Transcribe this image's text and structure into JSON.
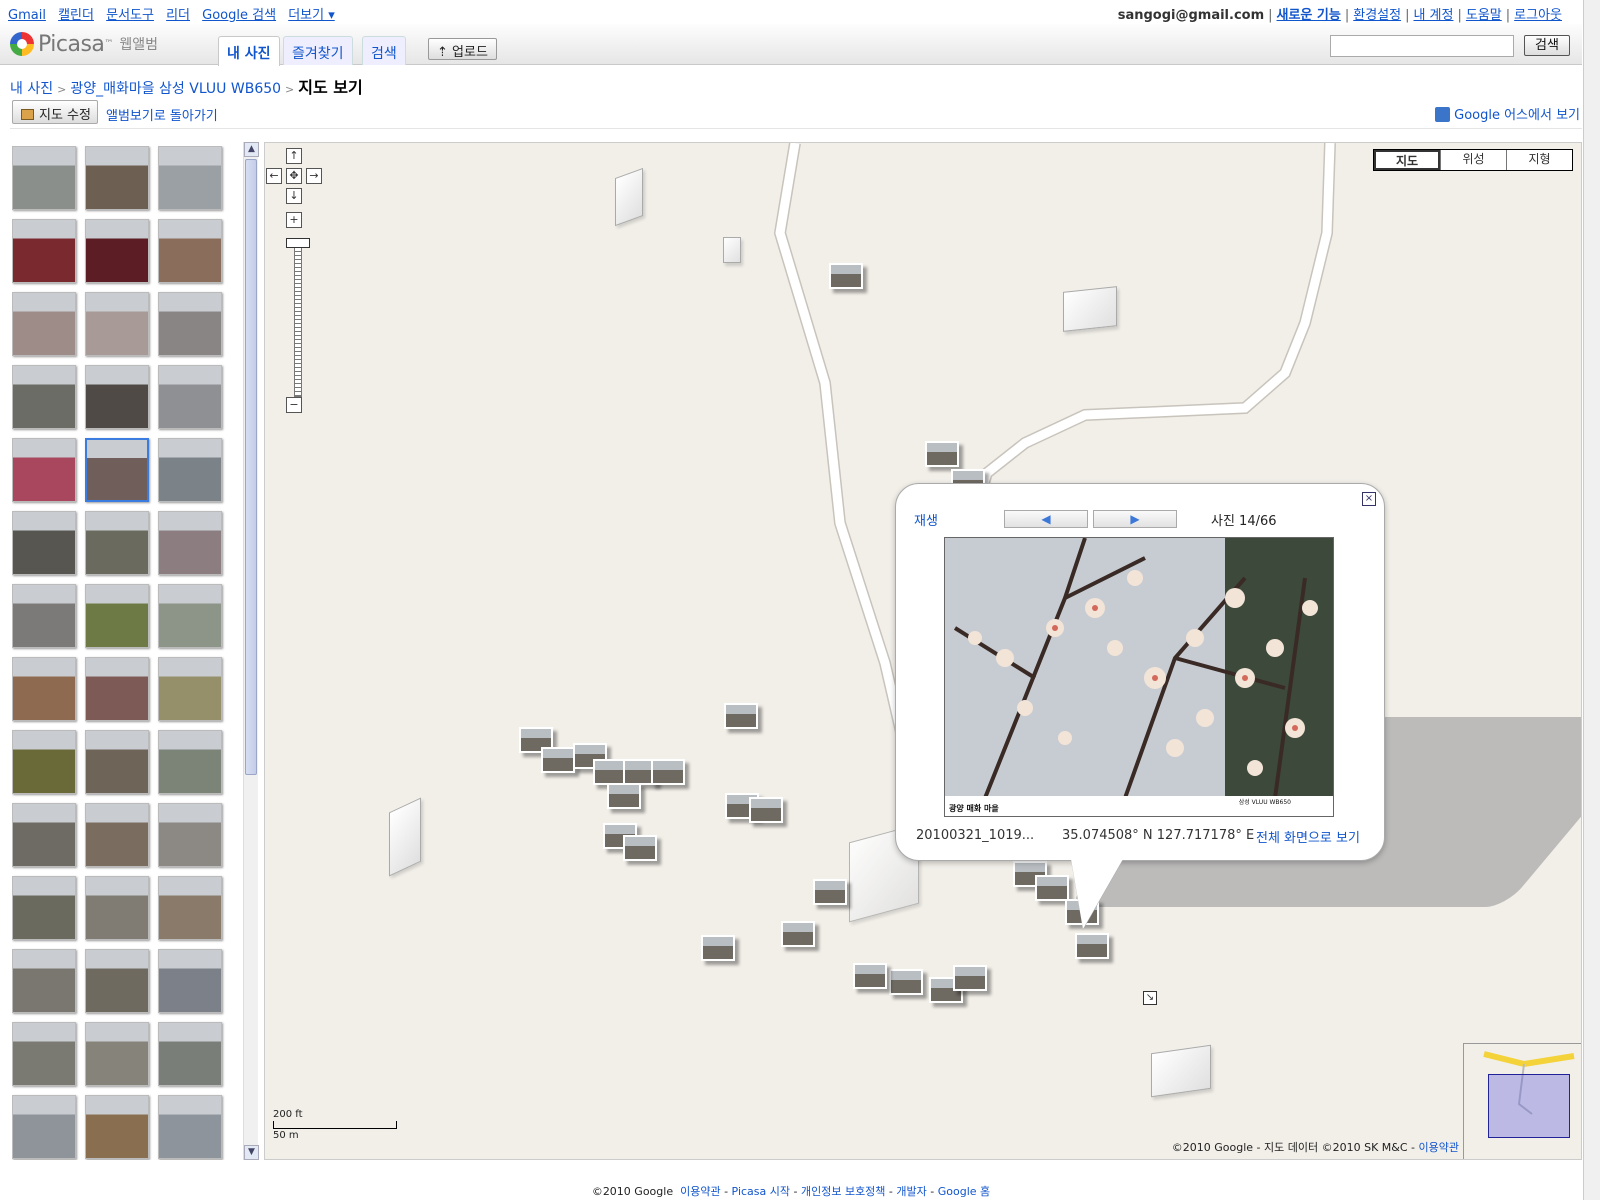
{
  "topbar": {
    "links": [
      "Gmail",
      "캘린더",
      "문서도구",
      "리더",
      "Google 검색",
      "더보기 ▾"
    ],
    "email": "sangogi@gmail.com",
    "right_links": [
      "새로운 기능",
      "환경설정",
      "내 계정",
      "도움말",
      "로그아웃"
    ]
  },
  "header": {
    "logo_word": "Picasa",
    "logo_tm": "™",
    "logo_sub": "웹앨범",
    "tabs": [
      "내 사진",
      "즐겨찾기",
      "검색"
    ],
    "upload": "업로드",
    "search_button": "검색",
    "search_value": ""
  },
  "breadcrumb": {
    "items": [
      "내 사진",
      "광양_매화마을 삼성 VLUU WB650"
    ],
    "current": "지도 보기"
  },
  "actions": {
    "edit_map": "지도 수정",
    "back_to_album": "앨범보기로 돌아가기",
    "google_earth": "Google 어스에서 보기"
  },
  "thumbnails": {
    "selected_index": 13,
    "count_visible": 42
  },
  "map": {
    "nav": {
      "up": "↑",
      "left": "←",
      "center": "✥",
      "right": "→",
      "down": "↓",
      "zoom_in": "+",
      "zoom_out": "−"
    },
    "types": [
      "지도",
      "위성",
      "지형"
    ],
    "scale": {
      "ft": "200 ft",
      "m": "50 m"
    },
    "copyright": "©2010 Google - 지도 데이터 ©2010 SK M&C - ",
    "copyright_link": "이용약관",
    "expand_icon": "↘"
  },
  "popup": {
    "play": "재생",
    "prev": "◀",
    "next": "▶",
    "counter": "사진 14/66",
    "filename": "20100321_1019...",
    "coords": "35.074508° N  127.717178° E",
    "fullscreen": "전체 화면으로 보기",
    "close": "×",
    "caption_left": "광양 매화 마을",
    "caption_right": "삼성 VLUU WB650"
  },
  "footer": {
    "copyright": "©2010 Google",
    "links": [
      "이용약관",
      "Picasa 시작",
      "개인정보 보호정책",
      "개발자",
      "Google 홈"
    ]
  },
  "colors": {
    "link": "#1155cc",
    "map_bg": "#f2efe9",
    "road": "#ffffff",
    "selection": "#3a7ce0"
  }
}
